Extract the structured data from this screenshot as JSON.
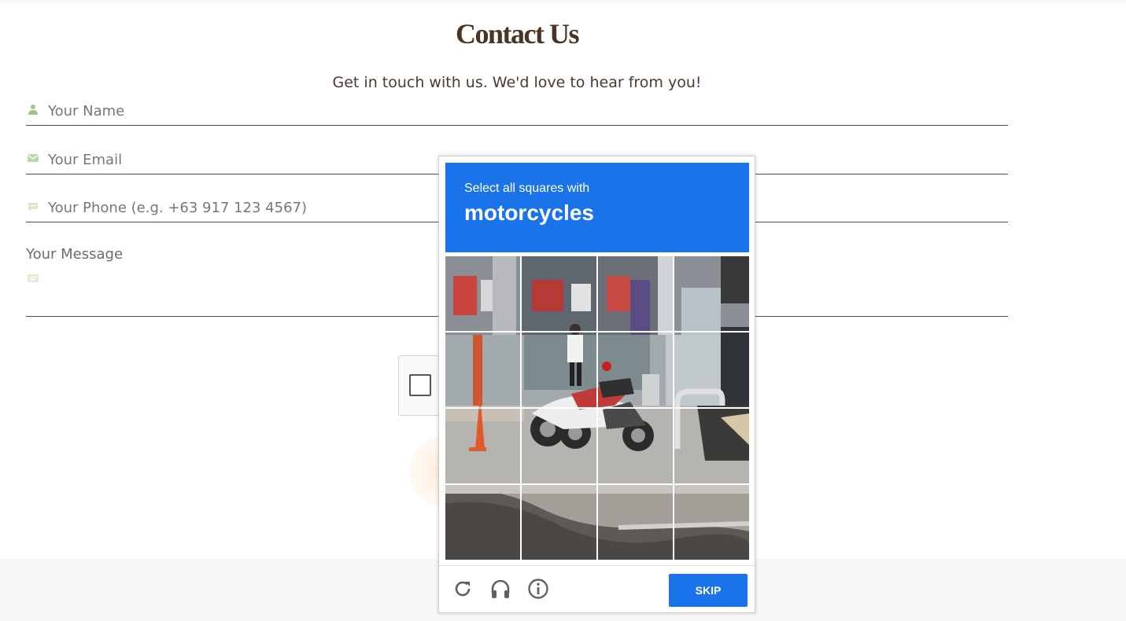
{
  "page": {
    "title": "Contact Us",
    "subtitle": "Get in touch with us. We'd love to hear from you!"
  },
  "form": {
    "name_placeholder": "Your Name",
    "email_placeholder": "Your Email",
    "phone_placeholder": "Your Phone (e.g. +63 917 123 4567)",
    "message_label": "Your Message",
    "icon_color": "#9ec48a"
  },
  "captcha": {
    "prompt_line1": "Select all squares with",
    "prompt_target": "motorcycles",
    "skip_label": "SKIP",
    "accent_color": "#1a73e8",
    "controls": [
      "reload-icon",
      "audio-headphones-icon",
      "info-icon"
    ],
    "grid_rows": 4,
    "grid_cols": 4
  }
}
